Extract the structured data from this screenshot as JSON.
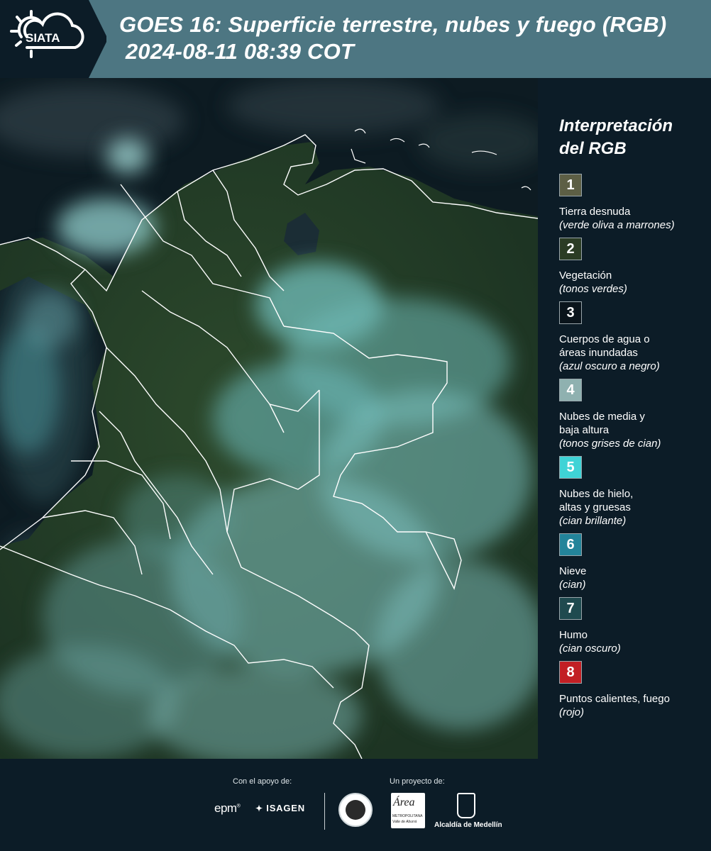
{
  "header": {
    "logo_text": "SIATA",
    "title_line1": "GOES 16: Superficie terrestre, nubes y fuego (RGB)",
    "title_line2": " 2024-08-11 08:39 COT",
    "background_color": "#4d7682"
  },
  "map": {
    "description_colors": {
      "ocean": "#0c1a22",
      "land": "#1f3a26",
      "clouds": "#7fcac6",
      "borders": "#ffffff"
    }
  },
  "legend": {
    "title_line1": "Interpretación",
    "title_line2": "del RGB",
    "items": [
      {
        "number": "1",
        "color": "#5d5f45",
        "label": "Tierra desnuda",
        "note": "(verde oliva a marrones)"
      },
      {
        "number": "2",
        "color": "#2b3c24",
        "label": "Vegetación",
        "note": "(tonos verdes)"
      },
      {
        "number": "3",
        "color": "#0a141b",
        "label": "Cuerpos de agua o\náreas inundadas",
        "note": "(azul oscuro a negro)"
      },
      {
        "number": "4",
        "color": "#8fb1b0",
        "label": "Nubes de media y\nbaja altura",
        "note": "(tonos grises de cian)"
      },
      {
        "number": "5",
        "color": "#3fd3d6",
        "label": "Nubes de hielo,\naltas y gruesas",
        "note": "(cian brillante)"
      },
      {
        "number": "6",
        "color": "#23849a",
        "label": "Nieve",
        "note": "(cian)"
      },
      {
        "number": "7",
        "color": "#1f4a4f",
        "label": "Humo",
        "note": "(cian oscuro)"
      },
      {
        "number": "8",
        "color": "#c21f24",
        "label": "Puntos calientes, fuego",
        "note": "(rojo)"
      }
    ]
  },
  "footer": {
    "support_caption": "Con el apoyo de:",
    "project_caption": "Un proyecto de:",
    "epm": "epm",
    "isagen": "ISAGEN",
    "area_metro": "Área",
    "area_metro_sub": "METROPOLITANA",
    "area_metro_sub2": "Valle de Aburrá",
    "alcaldia": "Alcaldía de Medellín"
  }
}
